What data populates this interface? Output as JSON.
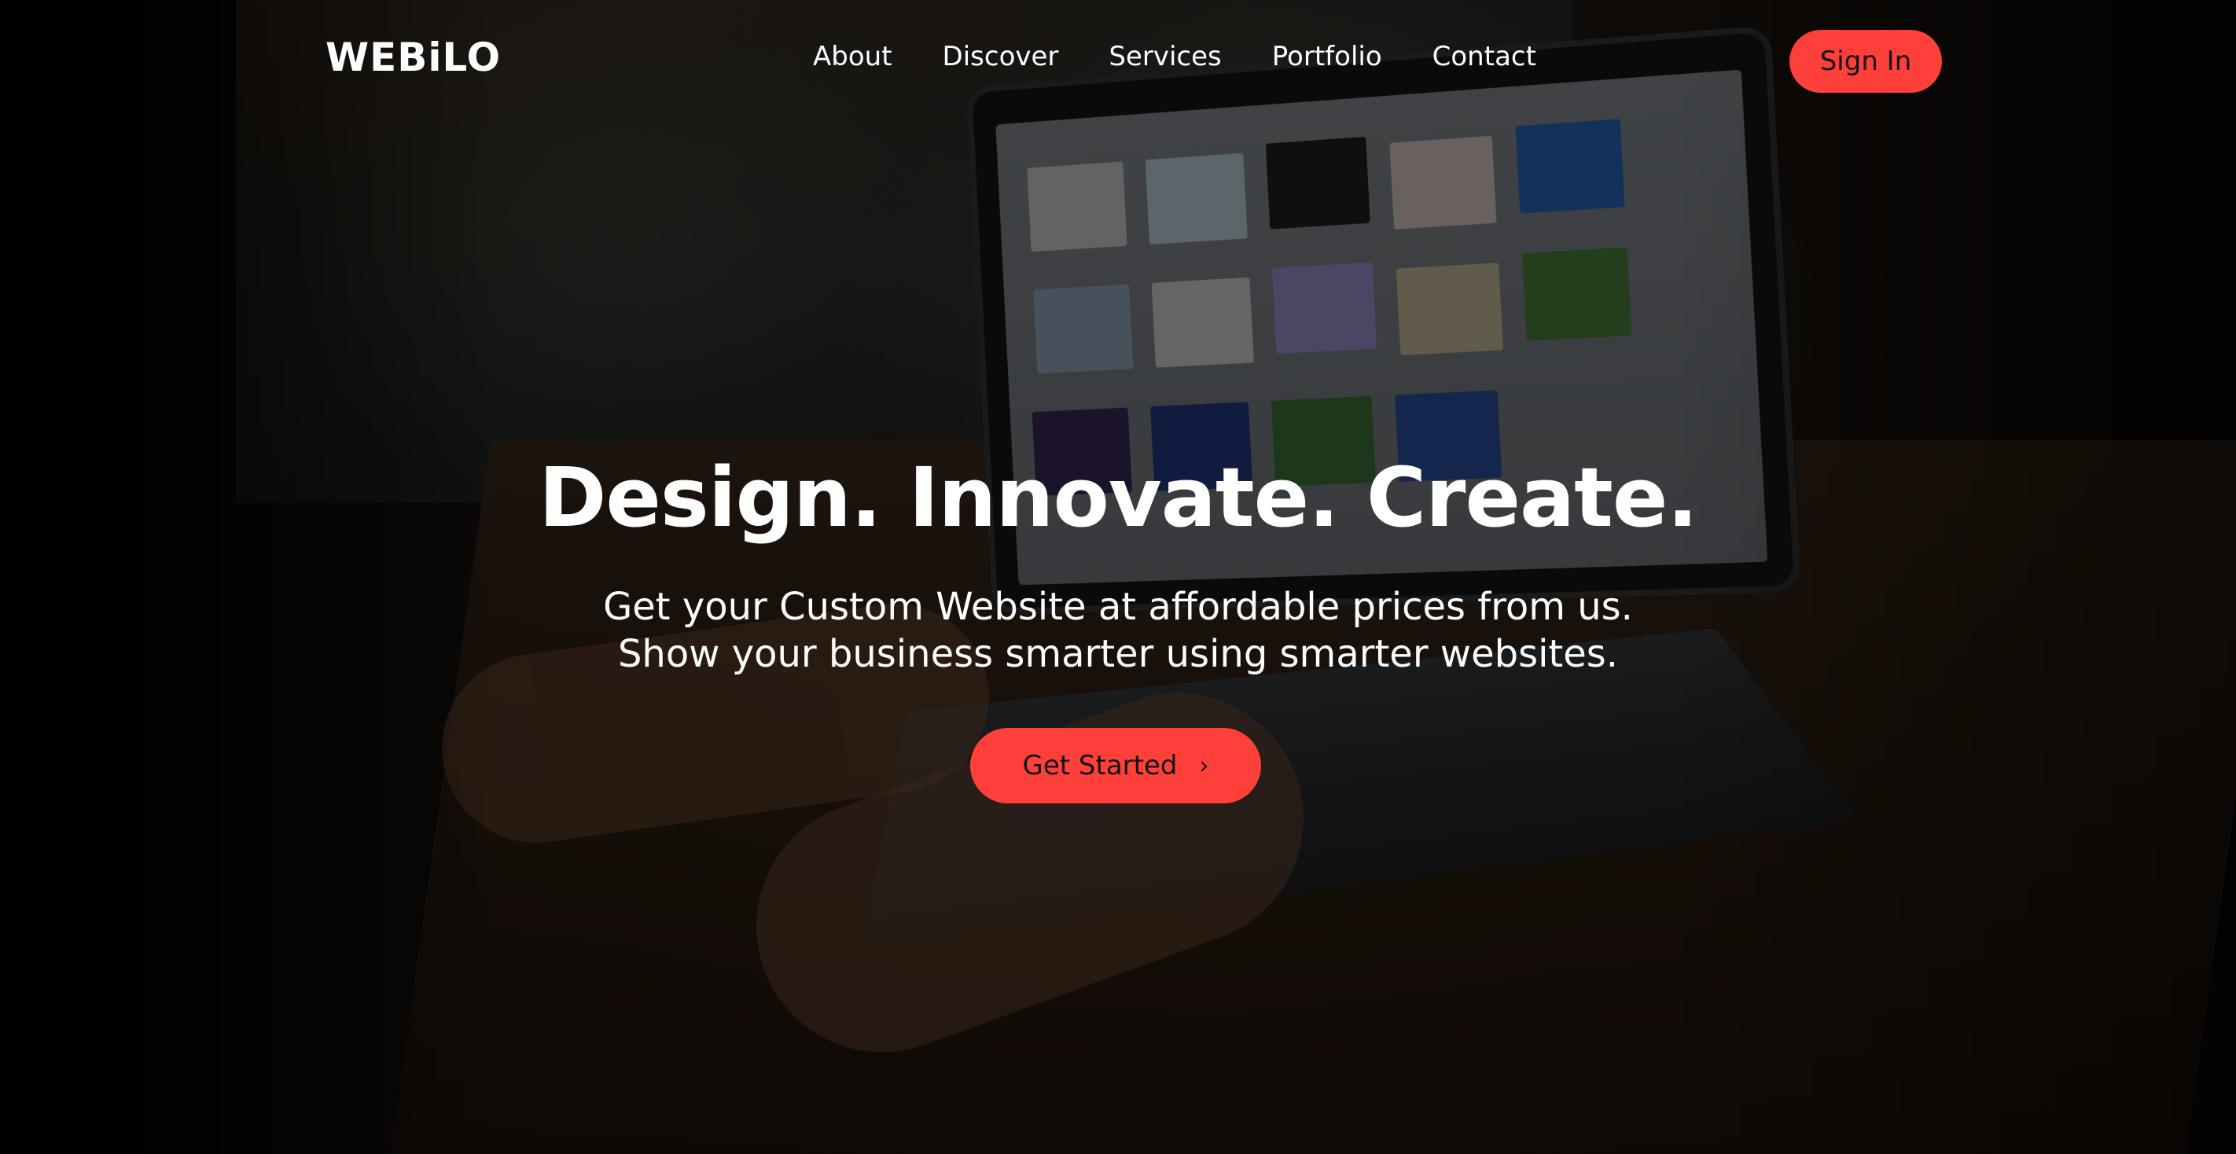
{
  "nav": {
    "logo": "WEBiLO",
    "links": [
      "About",
      "Discover",
      "Services",
      "Portfolio",
      "Contact"
    ],
    "signin_label": "Sign In"
  },
  "hero": {
    "title": "Design. Innovate. Create.",
    "subtitle_line1": "Get your Custom Website at affordable prices from us.",
    "subtitle_line2": "Show your business smarter using smarter websites.",
    "cta_label": "Get Started",
    "cta_icon": "chevron-right-icon"
  },
  "colors": {
    "accent": "#ff3f3a",
    "text": "#ffffff",
    "button_text": "#111111"
  }
}
